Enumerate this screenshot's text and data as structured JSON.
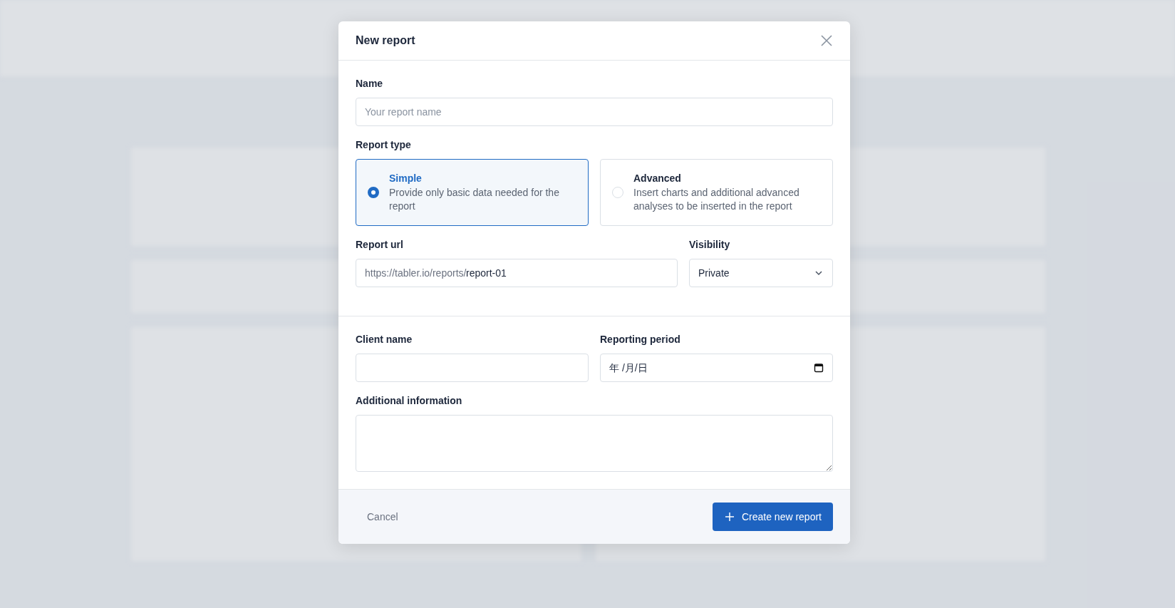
{
  "dialog": {
    "title": "New report",
    "name_field": {
      "label": "Name",
      "placeholder": "Your report name"
    },
    "report_type": {
      "label": "Report type",
      "options": [
        {
          "title": "Simple",
          "description": "Provide only basic data needed for the report",
          "selected": true
        },
        {
          "title": "Advanced",
          "description": "Insert charts and additional advanced analyses to be inserted in the report",
          "selected": false
        }
      ]
    },
    "url_field": {
      "label": "Report url",
      "prefix": "https://tabler.io/reports/",
      "value": "report-01"
    },
    "visibility": {
      "label": "Visibility",
      "value": "Private"
    },
    "client_field": {
      "label": "Client name"
    },
    "period_field": {
      "label": "Reporting period",
      "placeholder": "年 /月/日"
    },
    "info_field": {
      "label": "Additional information"
    },
    "buttons": [
      {
        "kind": "link",
        "label": "Cancel"
      },
      {
        "kind": "primary",
        "label": "Create new report"
      }
    ]
  }
}
